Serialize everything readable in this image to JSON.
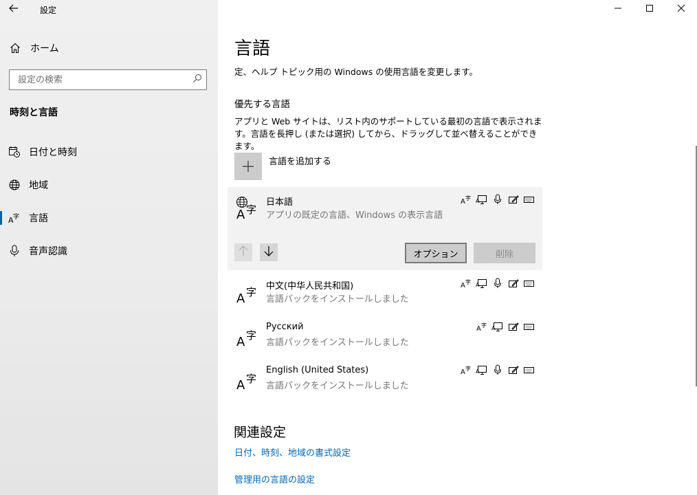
{
  "colors": {
    "accent": "#0063b1",
    "link": "#0067b8",
    "sidebar_bg": "#ececec",
    "selected_bg": "#f2f2f2",
    "button_bg": "#cccccc"
  },
  "sidebar": {
    "back_icon": "back-arrow-icon",
    "app_title": "設定",
    "home": {
      "icon": "home-icon",
      "label": "ホーム"
    },
    "search": {
      "placeholder": "設定の検索",
      "icon": "search-icon"
    },
    "section_title": "時刻と言語",
    "items": [
      {
        "icon": "calendar-clock-icon",
        "label": "日付と時刻",
        "active": false
      },
      {
        "icon": "globe-icon",
        "label": "地域",
        "active": false
      },
      {
        "icon": "language-icon",
        "label": "言語",
        "active": true
      },
      {
        "icon": "microphone-icon",
        "label": "音声認識",
        "active": false
      }
    ]
  },
  "window_controls": [
    "minimize-icon",
    "maximize-icon",
    "close-icon"
  ],
  "main": {
    "title": "言語",
    "subtitle": "定、ヘルプ トピック用の Windows の使用言語を変更します。",
    "preferred": {
      "heading": "優先する言語",
      "description": "アプリと Web サイトは、リスト内のサポートしている最初の言語で表示されます。言語を長押し (または選択) してから、ドラッグして並べ替えることができます。",
      "add_label": "言語を追加する",
      "languages": [
        {
          "name": "日本語",
          "sub": "アプリの既定の言語、Windows の表示言語",
          "icon": "display-language-icon",
          "features": [
            "text-to-speech-icon",
            "display-icon",
            "microphone-icon",
            "handwriting-icon",
            "keyboard-icon"
          ]
        },
        {
          "name": "中文(中华人民共和国)",
          "sub": "言語パックをインストールしました",
          "icon": "language-icon",
          "features": [
            "text-to-speech-icon",
            "display-icon",
            "microphone-icon",
            "handwriting-icon",
            "keyboard-icon"
          ]
        },
        {
          "name": "Русский",
          "sub": "言語パックをインストールしました",
          "icon": "language-icon",
          "features": [
            "text-to-speech-icon",
            "display-icon",
            "handwriting-icon",
            "keyboard-icon"
          ]
        },
        {
          "name": "English (United States)",
          "sub": "言語パックをインストールしました",
          "icon": "language-icon",
          "features": [
            "text-to-speech-icon",
            "display-icon",
            "microphone-icon",
            "handwriting-icon",
            "keyboard-icon"
          ]
        }
      ],
      "options_label": "オプション",
      "remove_label": "削除"
    },
    "related": {
      "title": "関連設定",
      "links": [
        "日付、時刻、地域の書式設定",
        "管理用の言語の設定"
      ]
    }
  }
}
